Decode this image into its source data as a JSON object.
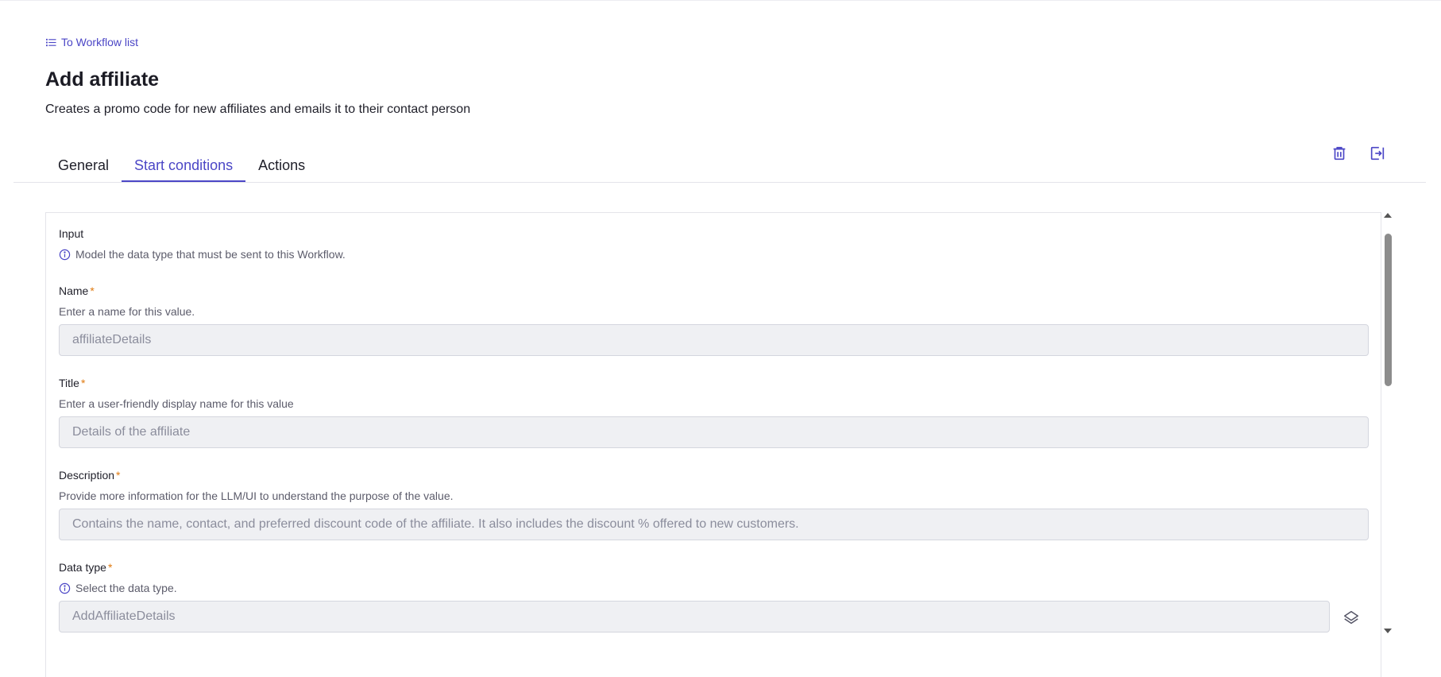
{
  "breadcrumb": {
    "back_label": "To Workflow list"
  },
  "page": {
    "title": "Add affiliate",
    "subtitle": "Creates a promo code for new affiliates and emails it to their contact person"
  },
  "tabs": [
    {
      "label": "General",
      "active": false
    },
    {
      "label": "Start conditions",
      "active": true
    },
    {
      "label": "Actions",
      "active": false
    }
  ],
  "header_actions": {
    "delete_icon": "trash-icon",
    "exit_icon": "exit-icon"
  },
  "form": {
    "section_title": "Input",
    "section_help": "Model the data type that must be sent to this Workflow.",
    "required_marker": "*",
    "fields": {
      "name": {
        "label": "Name",
        "help": "Enter a name for this value.",
        "value": "affiliateDetails"
      },
      "title": {
        "label": "Title",
        "help": "Enter a user-friendly display name for this value",
        "value": "Details of the affiliate"
      },
      "description": {
        "label": "Description",
        "help": "Provide more information for the LLM/UI to understand the purpose of the value.",
        "value": "Contains the name, contact, and preferred discount code of the affiliate. It also includes the discount % offered to new customers."
      },
      "data_type": {
        "label": "Data type",
        "help": "Select the data type.",
        "value": "AddAffiliateDetails"
      }
    }
  },
  "colors": {
    "accent": "#4b46c6",
    "required": "#e07a10",
    "input_bg": "#eff0f3"
  }
}
